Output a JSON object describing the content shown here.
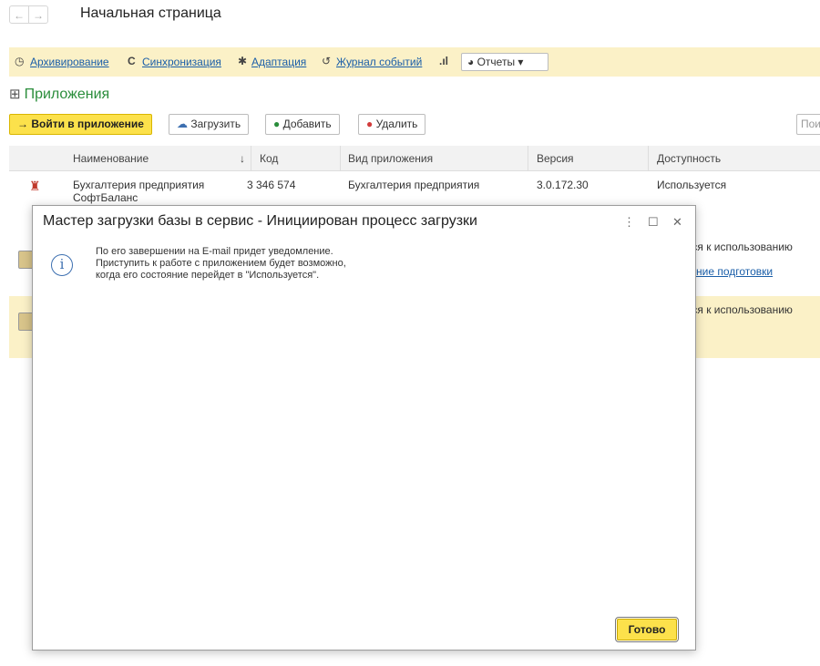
{
  "header": {
    "back": "←",
    "forward": "→",
    "title": "Начальная страница"
  },
  "commands": {
    "archive": "Архивирование",
    "sync": "Синхронизация",
    "adapt": "Адаптация",
    "events": "Журнал событий",
    "reports": "Отчеты"
  },
  "section": {
    "title": "Приложения"
  },
  "actions": {
    "enter": "Войти в приложение",
    "upload": "Загрузить",
    "add": "Добавить",
    "delete": "Удалить",
    "search_placeholder": "Пои"
  },
  "table": {
    "columns": [
      "Наименование",
      "↓",
      "Код",
      "Вид приложения",
      "Версия",
      "Доступность"
    ],
    "rows": [
      {
        "name_line1": "Бухгалтерия предприятия",
        "name_line2": "СофтБаланс",
        "code": "3 346 574",
        "kind": "Бухгалтерия предприятия",
        "version": "3.0.172.30",
        "status": "Используется"
      },
      {
        "status": "тся к использованию",
        "link": "ние подготовки"
      },
      {
        "status": "тся к использованию"
      }
    ]
  },
  "dialog": {
    "title": "Мастер загрузки базы в сервис - Инициирован процесс загрузки",
    "menu_icon": "⋮",
    "maximize_icon": "☐",
    "close_icon": "✕",
    "info_icon": "i",
    "message_line1": "По его завершении на E-mail придет уведомление.",
    "message_line2": "Приступить к работе с приложением будет возможно,",
    "message_line3": "когда его состояние перейдет в \"Используется\".",
    "done": "Готово"
  }
}
